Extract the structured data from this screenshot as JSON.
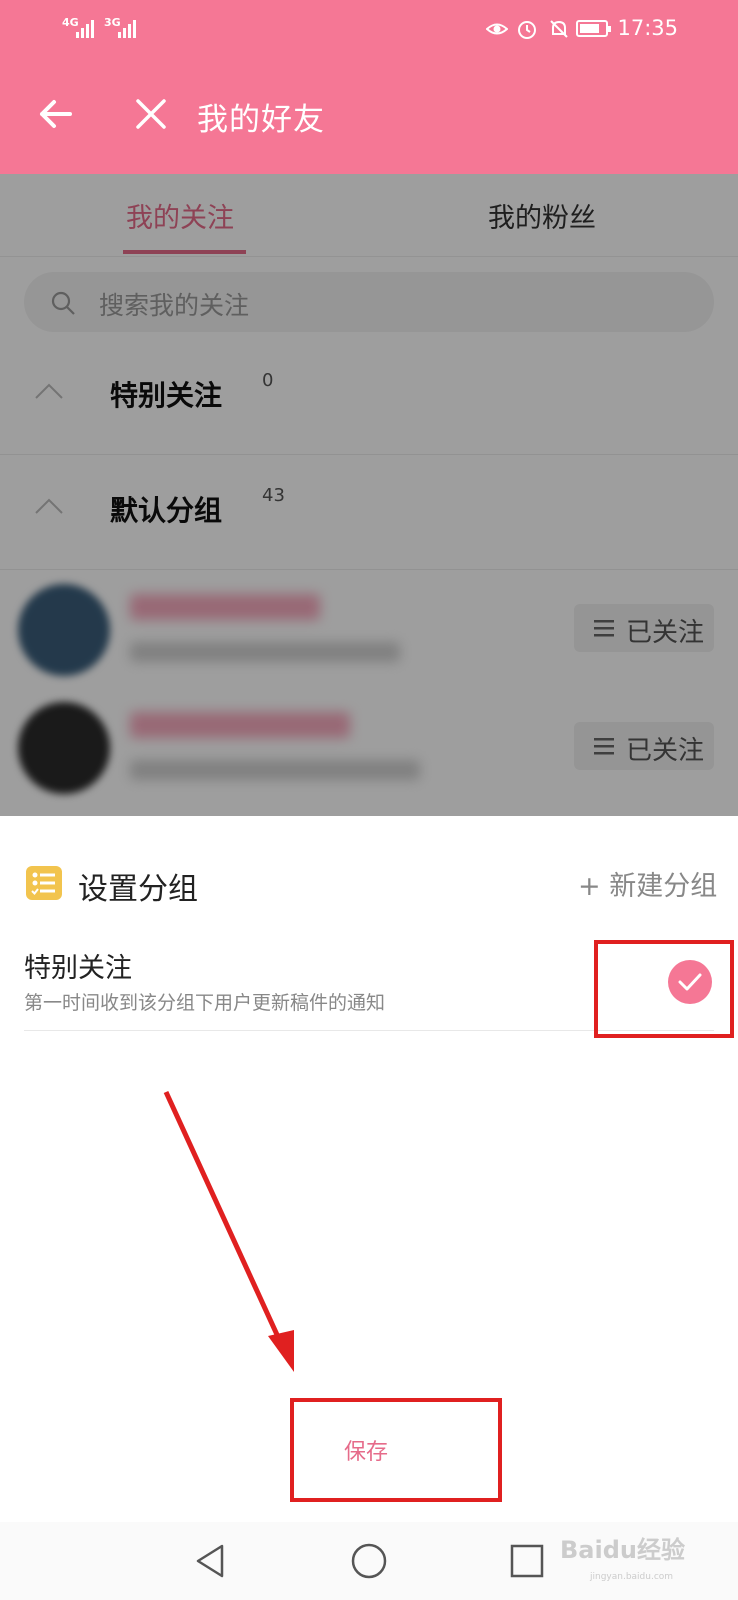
{
  "status_bar": {
    "signal_1": "4G",
    "signal_2": "3G",
    "time": "17:35",
    "battery_level": 0.8
  },
  "header": {
    "title": "我的好友",
    "back_icon": "arrow-left-icon",
    "close_icon": "close-icon"
  },
  "tabs": [
    {
      "label": "我的关注",
      "active": true
    },
    {
      "label": "我的粉丝",
      "active": false
    }
  ],
  "search": {
    "placeholder": "搜索我的关注"
  },
  "groups": [
    {
      "name": "特别关注",
      "count": "0"
    },
    {
      "name": "默认分组",
      "count": "43"
    }
  ],
  "users": [
    {
      "follow_label": "已关注"
    },
    {
      "follow_label": "已关注"
    }
  ],
  "sheet": {
    "title": "设置分组",
    "new_group": "+ 新建分组",
    "option_title": "特别关注",
    "option_subtitle": "第一时间收到该分组下用户更新稿件的通知",
    "option_checked": true,
    "save_label": "保存"
  },
  "colors": {
    "brand": "#f57795",
    "accent_text": "#e66b8a",
    "annotation": "#e02020"
  },
  "watermark": {
    "text": "Baidu经验",
    "sub": "jingyan.baidu.com"
  }
}
